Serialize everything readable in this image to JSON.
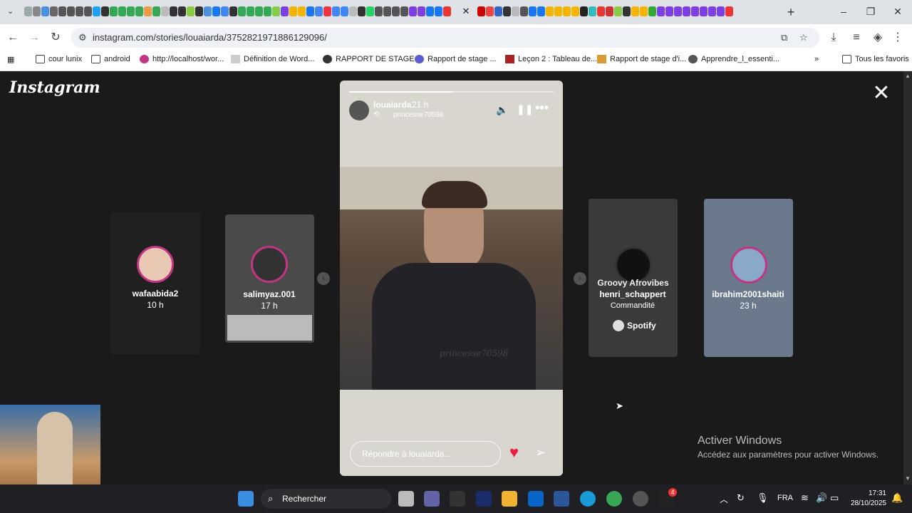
{
  "browser": {
    "url": "instagram.com/stories/louaiarda/3752821971886129096/",
    "bookmarks": [
      "cour lunix",
      "android",
      "http://localhost/wor...",
      "Définition de Word...",
      "RAPPORT DE STAGE...",
      "Rapport de stage ...",
      "Leçon 2 : Tableau de...",
      "Rapport de stage d'i...",
      "Apprendre_l_essenti..."
    ],
    "all_favorites": "Tous les favoris"
  },
  "instagram": {
    "logo": "Instagram",
    "stories_left": [
      {
        "name": "wafaabida2",
        "time": "10 h"
      },
      {
        "name": "salimyaz.001",
        "time": "17 h"
      }
    ],
    "stories_right": [
      {
        "name": "henri_schappert",
        "sub": "Commandité",
        "overlay": "Groovy Afrovibes",
        "brand": "Spotify"
      },
      {
        "name": "ibrahim2001shaiti",
        "time": "23 h"
      }
    ],
    "current": {
      "user": "louaiarda",
      "time": "21 h",
      "shared_from": "princesse70598",
      "watermark": "princesse70598",
      "reply_placeholder": "Répondre à louaiarda..."
    }
  },
  "windows": {
    "activate_title": "Activer Windows",
    "activate_sub": "Accédez aux paramètres pour activer Windows.",
    "search": "Rechercher",
    "lang": "FRA",
    "time": "17:31",
    "date": "28/10/2025",
    "badge": "4"
  }
}
